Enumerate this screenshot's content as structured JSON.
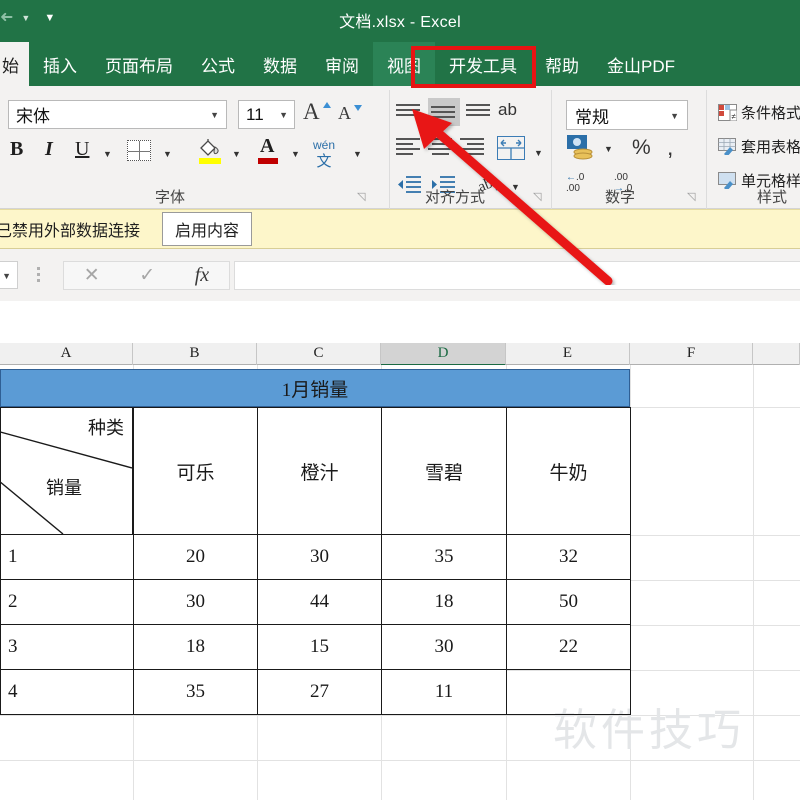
{
  "titlebar": {
    "document_title": "文档.xlsx  -  Excel",
    "qat": [
      {
        "name": "redo-icon",
        "glyph": "↷"
      },
      {
        "name": "customize-qat-icon",
        "glyph": "▼"
      }
    ]
  },
  "ribbon_tabs": [
    {
      "id": "home",
      "label": "始",
      "active": true
    },
    {
      "id": "insert",
      "label": "插入",
      "active": false
    },
    {
      "id": "page-layout",
      "label": "页面布局",
      "active": false
    },
    {
      "id": "formulas",
      "label": "公式",
      "active": false
    },
    {
      "id": "data",
      "label": "数据",
      "active": false
    },
    {
      "id": "review",
      "label": "审阅",
      "active": false
    },
    {
      "id": "view",
      "label": "视图",
      "active": false,
      "highlighted": true
    },
    {
      "id": "developer",
      "label": "开发工具",
      "active": false
    },
    {
      "id": "help",
      "label": "帮助",
      "active": false
    },
    {
      "id": "kingsoft-pdf",
      "label": "金山PDF",
      "active": false
    }
  ],
  "ribbon": {
    "font_group": {
      "label": "字体",
      "font_name": "宋体",
      "font_size": "11",
      "grow_font": "A",
      "shrink_font": "A",
      "bold": "B",
      "italic": "I",
      "underline": "U",
      "phonetic_top": "wén",
      "phonetic_bottom": "文",
      "font_color_swatch": "#c00000",
      "fill_color_swatch": "#ffff00"
    },
    "alignment_group": {
      "label": "对齐方式",
      "wrap_text": "ab"
    },
    "number_group": {
      "label": "数字",
      "format": "常规",
      "percent": "%",
      "comma": ",",
      "increase_decimal": ".00",
      "decrease_decimal": ".0"
    },
    "styles_group": {
      "label": "样式",
      "items": [
        "条件格式",
        "套用表格格式",
        "单元格样式"
      ]
    }
  },
  "security_bar": {
    "message": "已禁用外部数据连接",
    "button": "启用内容"
  },
  "formula_bar": {
    "name_box_value": "",
    "cancel_icon": "✕",
    "confirm_icon": "✓",
    "function_icon": "fx",
    "formula_value": ""
  },
  "grid": {
    "column_headers": [
      "A",
      "B",
      "C",
      "D",
      "E",
      "F"
    ],
    "selected_column": "D"
  },
  "table": {
    "title": "1月销量",
    "corner": {
      "top_label": "种类",
      "bottom_label": "销量"
    },
    "headers": [
      "可乐",
      "橙汁",
      "雪碧",
      "牛奶"
    ],
    "rows": [
      {
        "label": "1",
        "values": [
          "20",
          "30",
          "35",
          "32"
        ]
      },
      {
        "label": "2",
        "values": [
          "30",
          "44",
          "18",
          "50"
        ]
      },
      {
        "label": "3",
        "values": [
          "18",
          "15",
          "30",
          "22"
        ]
      },
      {
        "label": "4",
        "values": [
          "35",
          "27",
          "11",
          ""
        ]
      }
    ]
  },
  "watermark": "软件技巧",
  "annotation": {
    "highlight_target": "视图",
    "highlight_color": "#e81313"
  },
  "colors": {
    "excel_green": "#217346",
    "table_blue": "#5B9BD5",
    "warning_yellow": "#fdf6ca",
    "annotation_red": "#e81313"
  }
}
